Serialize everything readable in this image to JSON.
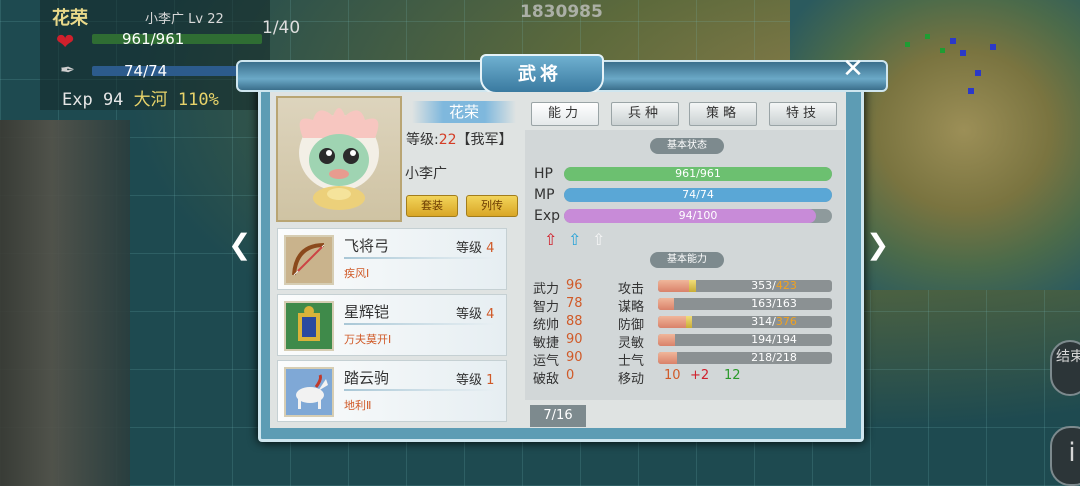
{
  "hud": {
    "hero_name": "花荣",
    "hero_sub": "小李广  Lv 22",
    "hp_text": "961/961",
    "mp_text": "74/74",
    "exp_label": "Exp 94",
    "terrain": "大河 110%",
    "turn": "1/40",
    "top_number": "1830985"
  },
  "dialog": {
    "title": "武将",
    "close_icon": "close-icon",
    "general": {
      "name": "花荣",
      "level_label": "等级:",
      "level": "22",
      "faction": "【我军】",
      "alias": "小李广",
      "btn_set": "套装",
      "btn_bio": "列传"
    },
    "tabs": [
      "能力",
      "兵种",
      "策略",
      "特技"
    ],
    "basic_status_label": "基本状态",
    "basic_ability_label": "基本能力",
    "bars": [
      {
        "label": "HP",
        "text": "961/961",
        "fill": 1.0,
        "color": "#6cc070"
      },
      {
        "label": "MP",
        "text": "74/74",
        "fill": 1.0,
        "color": "#5aa7d6"
      },
      {
        "label": "Exp",
        "text": "94/100",
        "fill": 0.94,
        "color": "#c88bd8"
      }
    ],
    "arrows": [
      "⇧",
      "⇧",
      "⇧"
    ],
    "attributes": [
      {
        "name": "武力",
        "value": "96"
      },
      {
        "name": "智力",
        "value": "78"
      },
      {
        "name": "统帅",
        "value": "88"
      },
      {
        "name": "敏捷",
        "value": "90"
      },
      {
        "name": "运气",
        "value": "90"
      },
      {
        "name": "破敌",
        "value": "0"
      }
    ],
    "combat": [
      {
        "name": "攻击",
        "base": "353",
        "sep": "/",
        "total": "423",
        "boosted": true,
        "fill": 0.18,
        "bonus": 0.04
      },
      {
        "name": "谋略",
        "base": "163",
        "sep": "/",
        "total": "163",
        "boosted": false,
        "fill": 0.09,
        "bonus": 0
      },
      {
        "name": "防御",
        "base": "314",
        "sep": "/",
        "total": "376",
        "boosted": true,
        "fill": 0.16,
        "bonus": 0.035
      },
      {
        "name": "灵敏",
        "base": "194",
        "sep": "/",
        "total": "194",
        "boosted": false,
        "fill": 0.1,
        "bonus": 0
      },
      {
        "name": "士气",
        "base": "218",
        "sep": "/",
        "total": "218",
        "boosted": false,
        "fill": 0.11,
        "bonus": 0
      }
    ],
    "move": {
      "name": "移动",
      "base": "10",
      "bonus": "+2",
      "total": "12"
    },
    "equipment": [
      {
        "name": "飞将弓",
        "level_label": "等级",
        "level": "4",
        "skill": "疾风Ⅰ",
        "icon": "bow-icon"
      },
      {
        "name": "星辉铠",
        "level_label": "等级",
        "level": "4",
        "skill": "万夫莫开Ⅰ",
        "icon": "armor-icon"
      },
      {
        "name": "踏云驹",
        "level_label": "等级",
        "level": "1",
        "skill": "地利Ⅱ",
        "icon": "horse-icon"
      }
    ],
    "page": "7/16"
  },
  "side": {
    "end_turn": "结束",
    "info": "i"
  }
}
